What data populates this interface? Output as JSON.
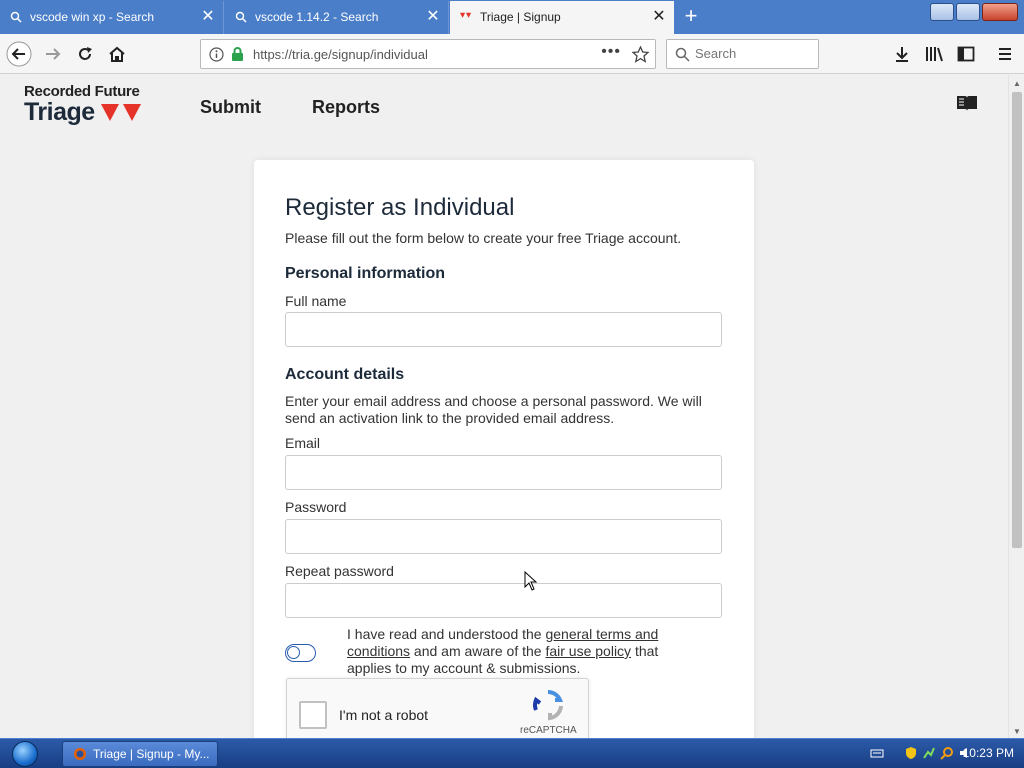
{
  "browser": {
    "tabs": [
      {
        "label": "vscode win xp - Search",
        "active": false
      },
      {
        "label": "vscode 1.14.2 - Search",
        "active": false
      },
      {
        "label": "Triage | Signup",
        "active": true
      }
    ],
    "url": "https://tria.ge/signup/individual",
    "search_placeholder": "Search"
  },
  "site": {
    "logo_top": "Recorded Future",
    "logo_main": "Triage",
    "nav": [
      "Submit",
      "Reports"
    ]
  },
  "form": {
    "title": "Register as Individual",
    "subtitle": "Please fill out the form below to create your free Triage account.",
    "personal_heading": "Personal information",
    "full_name_label": "Full name",
    "account_heading": "Account details",
    "account_desc": "Enter your email address and choose a personal password. We will send an activation link to the provided email address.",
    "email_label": "Email",
    "password_label": "Password",
    "repeat_password_label": "Repeat password",
    "terms_pre": "I have read and understood the ",
    "terms_link": "general terms and conditions",
    "terms_mid": " and am aware of the ",
    "fair_use_link": "fair use policy",
    "terms_post": " that applies to my account & submissions.",
    "captcha_label": "I'm not a robot",
    "captcha_brand": "reCAPTCHA"
  },
  "taskbar": {
    "task_label": "Triage | Signup - My...",
    "clock": "10:23 PM"
  },
  "colors": {
    "tabstrip": "#4a7ec9",
    "brand_red": "#e5332a",
    "taskbar": "#183e84"
  }
}
